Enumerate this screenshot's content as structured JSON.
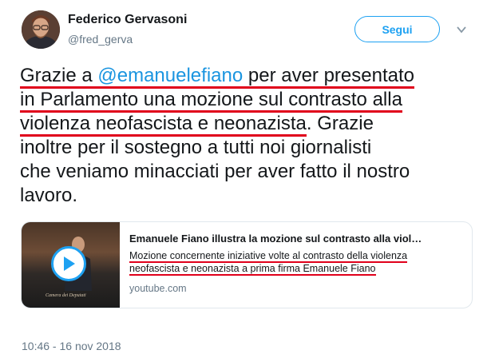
{
  "author": {
    "name": "Federico Gervasoni",
    "handle": "@fred_gerva"
  },
  "follow_button_label": "Segui",
  "tweet": {
    "line1_pre": "Grazie a ",
    "line1_mention": "@emanuelefiano",
    "line1_post": " per aver presentato",
    "line2": "in Parlamento una mozione sul contrasto alla",
    "line3_underlined": "violenza neofascista e neonazista",
    "line3_rest": ". Grazie",
    "line4": "inoltre per il sostegno a tutti noi giornalisti",
    "line5": "che veniamo minacciati per aver fatto il nostro",
    "line6": "lavoro."
  },
  "card": {
    "title": "Emanuele Fiano illustra la mozione sul contrasto alla viol…",
    "desc_line1": "Mozione concernente iniziative volte al contrasto della violenza",
    "desc_line2": "neofascista e neonazista a prima firma Emanuele Fiano",
    "domain": "youtube.com",
    "thumb_caption": "Camera dei Deputati"
  },
  "timestamp": "10:46 - 16 nov 2018",
  "colors": {
    "accent": "#1da1f2",
    "mention": "#1b95e0",
    "annotation_underline": "#e0001b",
    "secondary_text": "#657786"
  },
  "icons": {
    "avatar": "profile-photo",
    "caret": "chevron-down-icon",
    "play": "play-icon"
  }
}
